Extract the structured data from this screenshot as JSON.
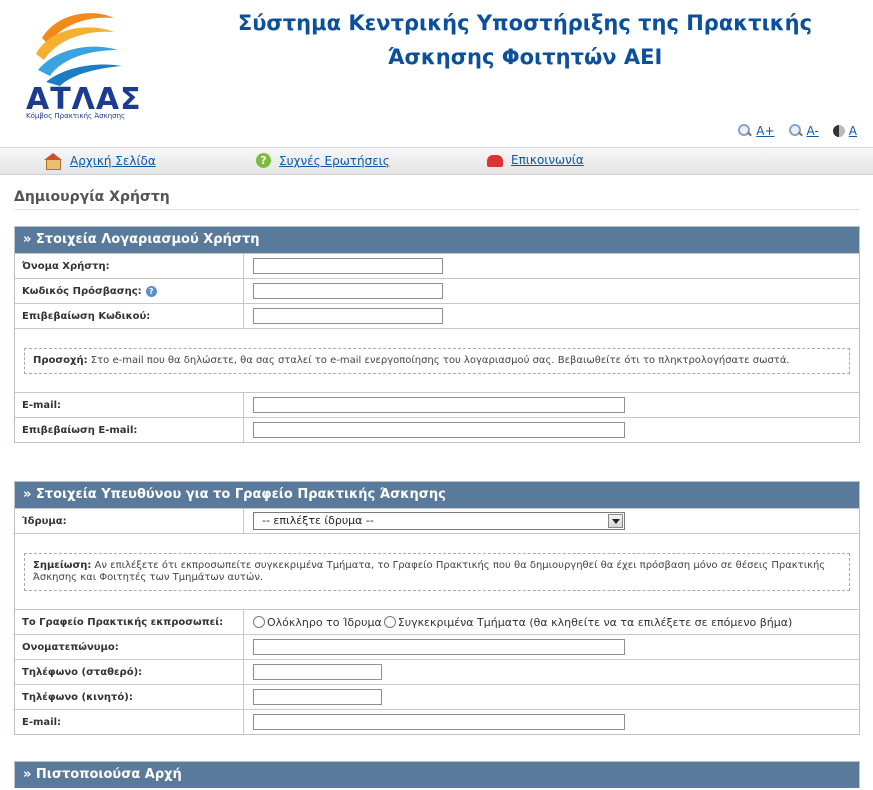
{
  "header": {
    "title_line1": "Σύστημα Κεντρικής Υποστήριξης της Πρακτικής",
    "title_line2": "Άσκησης Φοιτητών ΑΕΙ",
    "logo_word": "ΑΤΛΑΣ",
    "logo_sub": "Κόμβος Πρακτικής Άσκησης"
  },
  "accessibility": {
    "increase": "A+",
    "decrease": "A-",
    "contrast": "A"
  },
  "nav": {
    "home": "Αρχική Σελίδα",
    "faq": "Συχνές Ερωτήσεις",
    "contact": "Επικοινωνία"
  },
  "page_title": "Δημιουργία Χρήστη",
  "account": {
    "heading": "» Στοιχεία Λογαριασμού Χρήστη",
    "username_label": "Όνομα Χρήστη:",
    "password_label": "Κωδικός Πρόσβασης:",
    "password_confirm_label": "Επιβεβαίωση Κωδικού:",
    "notice_bold": "Προσοχή:",
    "notice_text": " Στο e-mail που θα δηλώσετε, θα σας σταλεί το e-mail ενεργοποίησης του λογαριασμού σας. Βεβαιωθείτε ότι το πληκτρολογήσατε σωστά.",
    "email_label": "E-mail:",
    "email_confirm_label": "Επιβεβαίωση E-mail:"
  },
  "responsible": {
    "heading": "» Στοιχεία Υπευθύνου για το Γραφείο Πρακτικής Άσκησης",
    "institution_label": "Ίδρυμα:",
    "institution_selected": "-- επιλέξτε ίδρυμα --",
    "notice_bold": "Σημείωση:",
    "notice_text": " Αν επιλέξετε ότι εκπροσωπείτε συγκεκριμένα Τμήματα, το Γραφείο Πρακτικής που θα δημιουργηθεί θα έχει πρόσβαση μόνο σε θέσεις Πρακτικής Άσκησης και Φοιτητές των Τμημάτων αυτών.",
    "represents_label": "Το Γραφείο Πρακτικής εκπροσωπεί:",
    "option_whole": "Ολόκληρο το Ίδρυμα",
    "option_specific": "Συγκεκριμένα Τμήματα (θα κληθείτε να τα επιλέξετε σε επόμενο βήμα)",
    "fullname_label": "Ονοματεπώνυμο:",
    "phone_fixed_label": "Τηλέφωνο (σταθερό):",
    "phone_mobile_label": "Τηλέφωνο (κινητό):",
    "email_label": "E-mail:"
  },
  "certifying": {
    "heading": "» Πιστοποιούσα Αρχή"
  },
  "colors": {
    "section_header": "#5a7a9c",
    "title_blue": "#0c4f9b",
    "link": "#0a5aa8"
  }
}
